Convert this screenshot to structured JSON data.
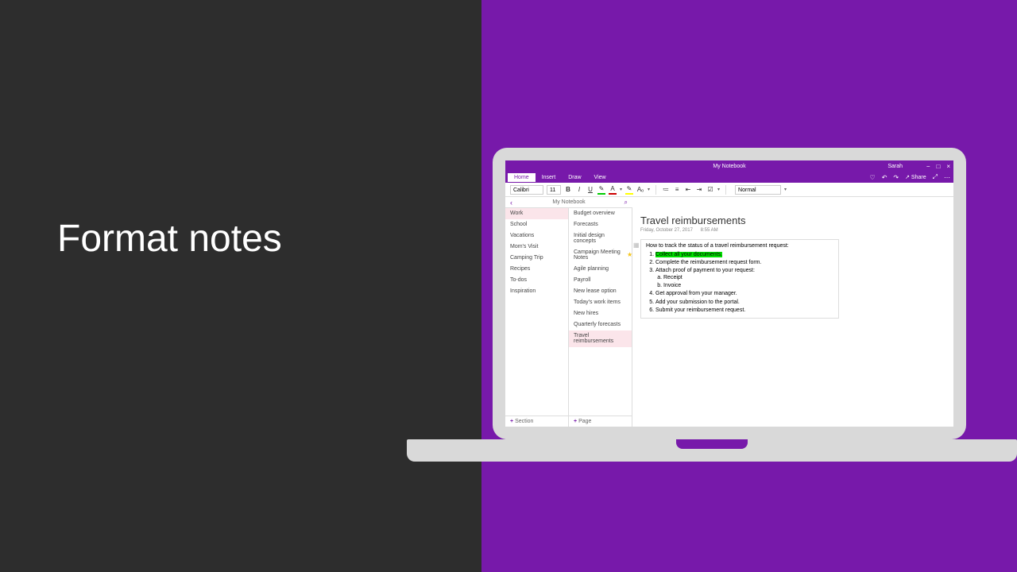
{
  "slide": {
    "title": "Format notes"
  },
  "titlebar": {
    "title": "My Notebook",
    "user": "Sarah"
  },
  "ribbonTabs": [
    "Home",
    "Insert",
    "Draw",
    "View"
  ],
  "ribbonIcons": {
    "share": "Share"
  },
  "ribbonBar": {
    "fontName": "Calibri",
    "fontSize": "11",
    "bold": "B",
    "italic": "I",
    "underline": "U",
    "pen": "✎",
    "fontColor": "A",
    "highlight": "✎",
    "clear": "Aₒ",
    "styleDropdown": "Normal"
  },
  "navHeader": {
    "title": "My Notebook"
  },
  "sections": [
    {
      "label": "Work",
      "selected": true
    },
    {
      "label": "School"
    },
    {
      "label": "Vacations"
    },
    {
      "label": "Mom's Visit"
    },
    {
      "label": "Camping Trip"
    },
    {
      "label": "Recipes"
    },
    {
      "label": "To-dos"
    },
    {
      "label": "Inspiration"
    }
  ],
  "addSection": "Section",
  "pages": [
    {
      "label": "Budget overview"
    },
    {
      "label": "Forecasts"
    },
    {
      "label": "Initial design concepts"
    },
    {
      "label": "Campaign Meeting Notes"
    },
    {
      "label": "Agile planning"
    },
    {
      "label": "Payroll"
    },
    {
      "label": "New lease option"
    },
    {
      "label": "Today's work items"
    },
    {
      "label": "New hires"
    },
    {
      "label": "Quarterly forecasts"
    },
    {
      "label": "Travel reimbursements",
      "selected": true
    }
  ],
  "addPage": "Page",
  "content": {
    "title": "Travel reimbursements",
    "date": "Friday, October 27, 2017",
    "time": "8:55 AM",
    "subtitle": "How to track the status of a travel reimbursement request:",
    "items": [
      {
        "text": "Collect all your documents.",
        "highlight": true
      },
      {
        "text": "Complete the reimbursement request form."
      },
      {
        "text": "Attach proof of payment to your request:",
        "sub": [
          "Receipt",
          "Invoice"
        ]
      },
      {
        "text": "Get approval from your manager."
      },
      {
        "text": "Add your submission to the portal."
      },
      {
        "text": "Submit your reimbursement request."
      }
    ]
  }
}
